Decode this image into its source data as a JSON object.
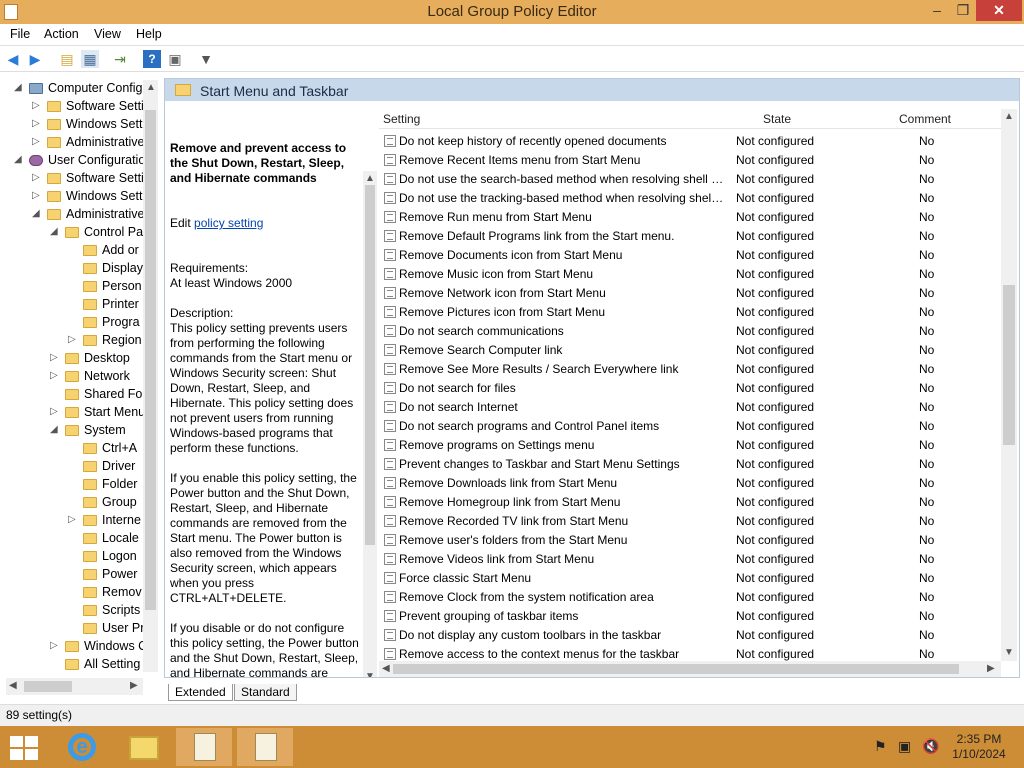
{
  "window": {
    "title": "Local Group Policy Editor",
    "minimize": "–",
    "maximize": "❐",
    "close": "✕"
  },
  "menu": [
    "File",
    "Action",
    "View",
    "Help"
  ],
  "toolbar": [
    "back-icon",
    "forward-icon",
    "up-folder-icon",
    "show-hide-tree-icon",
    "export-list-icon",
    "help-icon",
    "properties-icon",
    "filter-icon"
  ],
  "tree": [
    {
      "label": "Computer Configu",
      "indent": 0,
      "twisty": "open",
      "icon": "pc"
    },
    {
      "label": "Software Setti",
      "indent": 1,
      "twisty": "closed",
      "icon": "folder"
    },
    {
      "label": "Windows Setti",
      "indent": 1,
      "twisty": "closed",
      "icon": "folder"
    },
    {
      "label": "Administrative",
      "indent": 1,
      "twisty": "closed",
      "icon": "folder"
    },
    {
      "label": "User Configuratio",
      "indent": 0,
      "twisty": "open",
      "icon": "user"
    },
    {
      "label": "Software Setti",
      "indent": 1,
      "twisty": "closed",
      "icon": "folder"
    },
    {
      "label": "Windows Setti",
      "indent": 1,
      "twisty": "closed",
      "icon": "folder"
    },
    {
      "label": "Administrative",
      "indent": 1,
      "twisty": "open",
      "icon": "folder"
    },
    {
      "label": "Control Pa",
      "indent": 2,
      "twisty": "open",
      "icon": "folder"
    },
    {
      "label": "Add or",
      "indent": 3,
      "twisty": "",
      "icon": "folder"
    },
    {
      "label": "Display",
      "indent": 3,
      "twisty": "",
      "icon": "folder"
    },
    {
      "label": "Person",
      "indent": 3,
      "twisty": "",
      "icon": "folder"
    },
    {
      "label": "Printer",
      "indent": 3,
      "twisty": "",
      "icon": "folder"
    },
    {
      "label": "Progra",
      "indent": 3,
      "twisty": "",
      "icon": "folder"
    },
    {
      "label": "Region",
      "indent": 3,
      "twisty": "closed",
      "icon": "folder"
    },
    {
      "label": "Desktop",
      "indent": 2,
      "twisty": "closed",
      "icon": "folder"
    },
    {
      "label": "Network",
      "indent": 2,
      "twisty": "closed",
      "icon": "folder"
    },
    {
      "label": "Shared Fol",
      "indent": 2,
      "twisty": "",
      "icon": "folder"
    },
    {
      "label": "Start Menu",
      "indent": 2,
      "twisty": "closed",
      "icon": "folder"
    },
    {
      "label": "System",
      "indent": 2,
      "twisty": "open",
      "icon": "folder"
    },
    {
      "label": "Ctrl+A",
      "indent": 3,
      "twisty": "",
      "icon": "folder"
    },
    {
      "label": "Driver",
      "indent": 3,
      "twisty": "",
      "icon": "folder"
    },
    {
      "label": "Folder",
      "indent": 3,
      "twisty": "",
      "icon": "folder"
    },
    {
      "label": "Group",
      "indent": 3,
      "twisty": "",
      "icon": "folder"
    },
    {
      "label": "Interne",
      "indent": 3,
      "twisty": "closed",
      "icon": "folder"
    },
    {
      "label": "Locale",
      "indent": 3,
      "twisty": "",
      "icon": "folder"
    },
    {
      "label": "Logon",
      "indent": 3,
      "twisty": "",
      "icon": "folder"
    },
    {
      "label": "Power",
      "indent": 3,
      "twisty": "",
      "icon": "folder"
    },
    {
      "label": "Remov",
      "indent": 3,
      "twisty": "",
      "icon": "folder"
    },
    {
      "label": "Scripts",
      "indent": 3,
      "twisty": "",
      "icon": "folder"
    },
    {
      "label": "User Pr",
      "indent": 3,
      "twisty": "",
      "icon": "folder"
    },
    {
      "label": "Windows C",
      "indent": 2,
      "twisty": "closed",
      "icon": "folder"
    },
    {
      "label": "All Setting",
      "indent": 2,
      "twisty": "",
      "icon": "folder"
    }
  ],
  "pane": {
    "title": "Start Menu and Taskbar"
  },
  "description": {
    "title": "Remove and prevent access to the Shut Down, Restart, Sleep, and Hibernate commands",
    "edit_prefix": "Edit ",
    "edit_link": "policy setting",
    "body": "Requirements:\nAt least Windows 2000\n\nDescription:\nThis policy setting prevents users from performing the following commands from the Start menu or Windows Security screen: Shut Down, Restart, Sleep, and Hibernate. This policy setting does not prevent users from running Windows-based programs that perform these functions.\n\nIf you enable this policy setting, the Power button and the Shut Down, Restart, Sleep, and Hibernate commands are removed from the Start menu. The Power button is also removed from the Windows Security screen, which appears when you press CTRL+ALT+DELETE.\n\nIf you disable or do not configure this policy setting, the Power button and the Shut Down, Restart, Sleep, and Hibernate commands are available on the Start menu. The Power button on the Windows Security screen is also available."
  },
  "list": {
    "columns": [
      "Setting",
      "State",
      "Comment"
    ],
    "rows": [
      [
        "Do not keep history of recently opened documents",
        "Not configured",
        "No"
      ],
      [
        "Remove Recent Items menu from Start Menu",
        "Not configured",
        "No"
      ],
      [
        "Do not use the search-based method when resolving shell s...",
        "Not configured",
        "No"
      ],
      [
        "Do not use the tracking-based method when resolving shell ...",
        "Not configured",
        "No"
      ],
      [
        "Remove Run menu from Start Menu",
        "Not configured",
        "No"
      ],
      [
        "Remove Default Programs link from the Start menu.",
        "Not configured",
        "No"
      ],
      [
        "Remove Documents icon from Start Menu",
        "Not configured",
        "No"
      ],
      [
        "Remove Music icon from Start Menu",
        "Not configured",
        "No"
      ],
      [
        "Remove Network icon from Start Menu",
        "Not configured",
        "No"
      ],
      [
        "Remove Pictures icon from Start Menu",
        "Not configured",
        "No"
      ],
      [
        "Do not search communications",
        "Not configured",
        "No"
      ],
      [
        "Remove Search Computer link",
        "Not configured",
        "No"
      ],
      [
        "Remove See More Results / Search Everywhere link",
        "Not configured",
        "No"
      ],
      [
        "Do not search for files",
        "Not configured",
        "No"
      ],
      [
        "Do not search Internet",
        "Not configured",
        "No"
      ],
      [
        "Do not search programs and Control Panel items",
        "Not configured",
        "No"
      ],
      [
        "Remove programs on Settings menu",
        "Not configured",
        "No"
      ],
      [
        "Prevent changes to Taskbar and Start Menu Settings",
        "Not configured",
        "No"
      ],
      [
        "Remove Downloads link from Start Menu",
        "Not configured",
        "No"
      ],
      [
        "Remove Homegroup link from Start Menu",
        "Not configured",
        "No"
      ],
      [
        "Remove Recorded TV link from Start Menu",
        "Not configured",
        "No"
      ],
      [
        "Remove user's folders from the Start Menu",
        "Not configured",
        "No"
      ],
      [
        "Remove Videos link from Start Menu",
        "Not configured",
        "No"
      ],
      [
        "Force classic Start Menu",
        "Not configured",
        "No"
      ],
      [
        "Remove Clock from the system notification area",
        "Not configured",
        "No"
      ],
      [
        "Prevent grouping of taskbar items",
        "Not configured",
        "No"
      ],
      [
        "Do not display any custom toolbars in the taskbar",
        "Not configured",
        "No"
      ],
      [
        "Remove access to the context menus for the taskbar",
        "Not configured",
        "No"
      ]
    ]
  },
  "tabs": [
    "Extended",
    "Standard"
  ],
  "status": "89 setting(s)",
  "taskbar": {
    "time": "2:35 PM",
    "date": "1/10/2024"
  },
  "colors": {
    "titlebar": "#e6ad5c",
    "close": "#c7413a",
    "taskbar": "#cd8d36",
    "band": "#c7d8ea"
  }
}
